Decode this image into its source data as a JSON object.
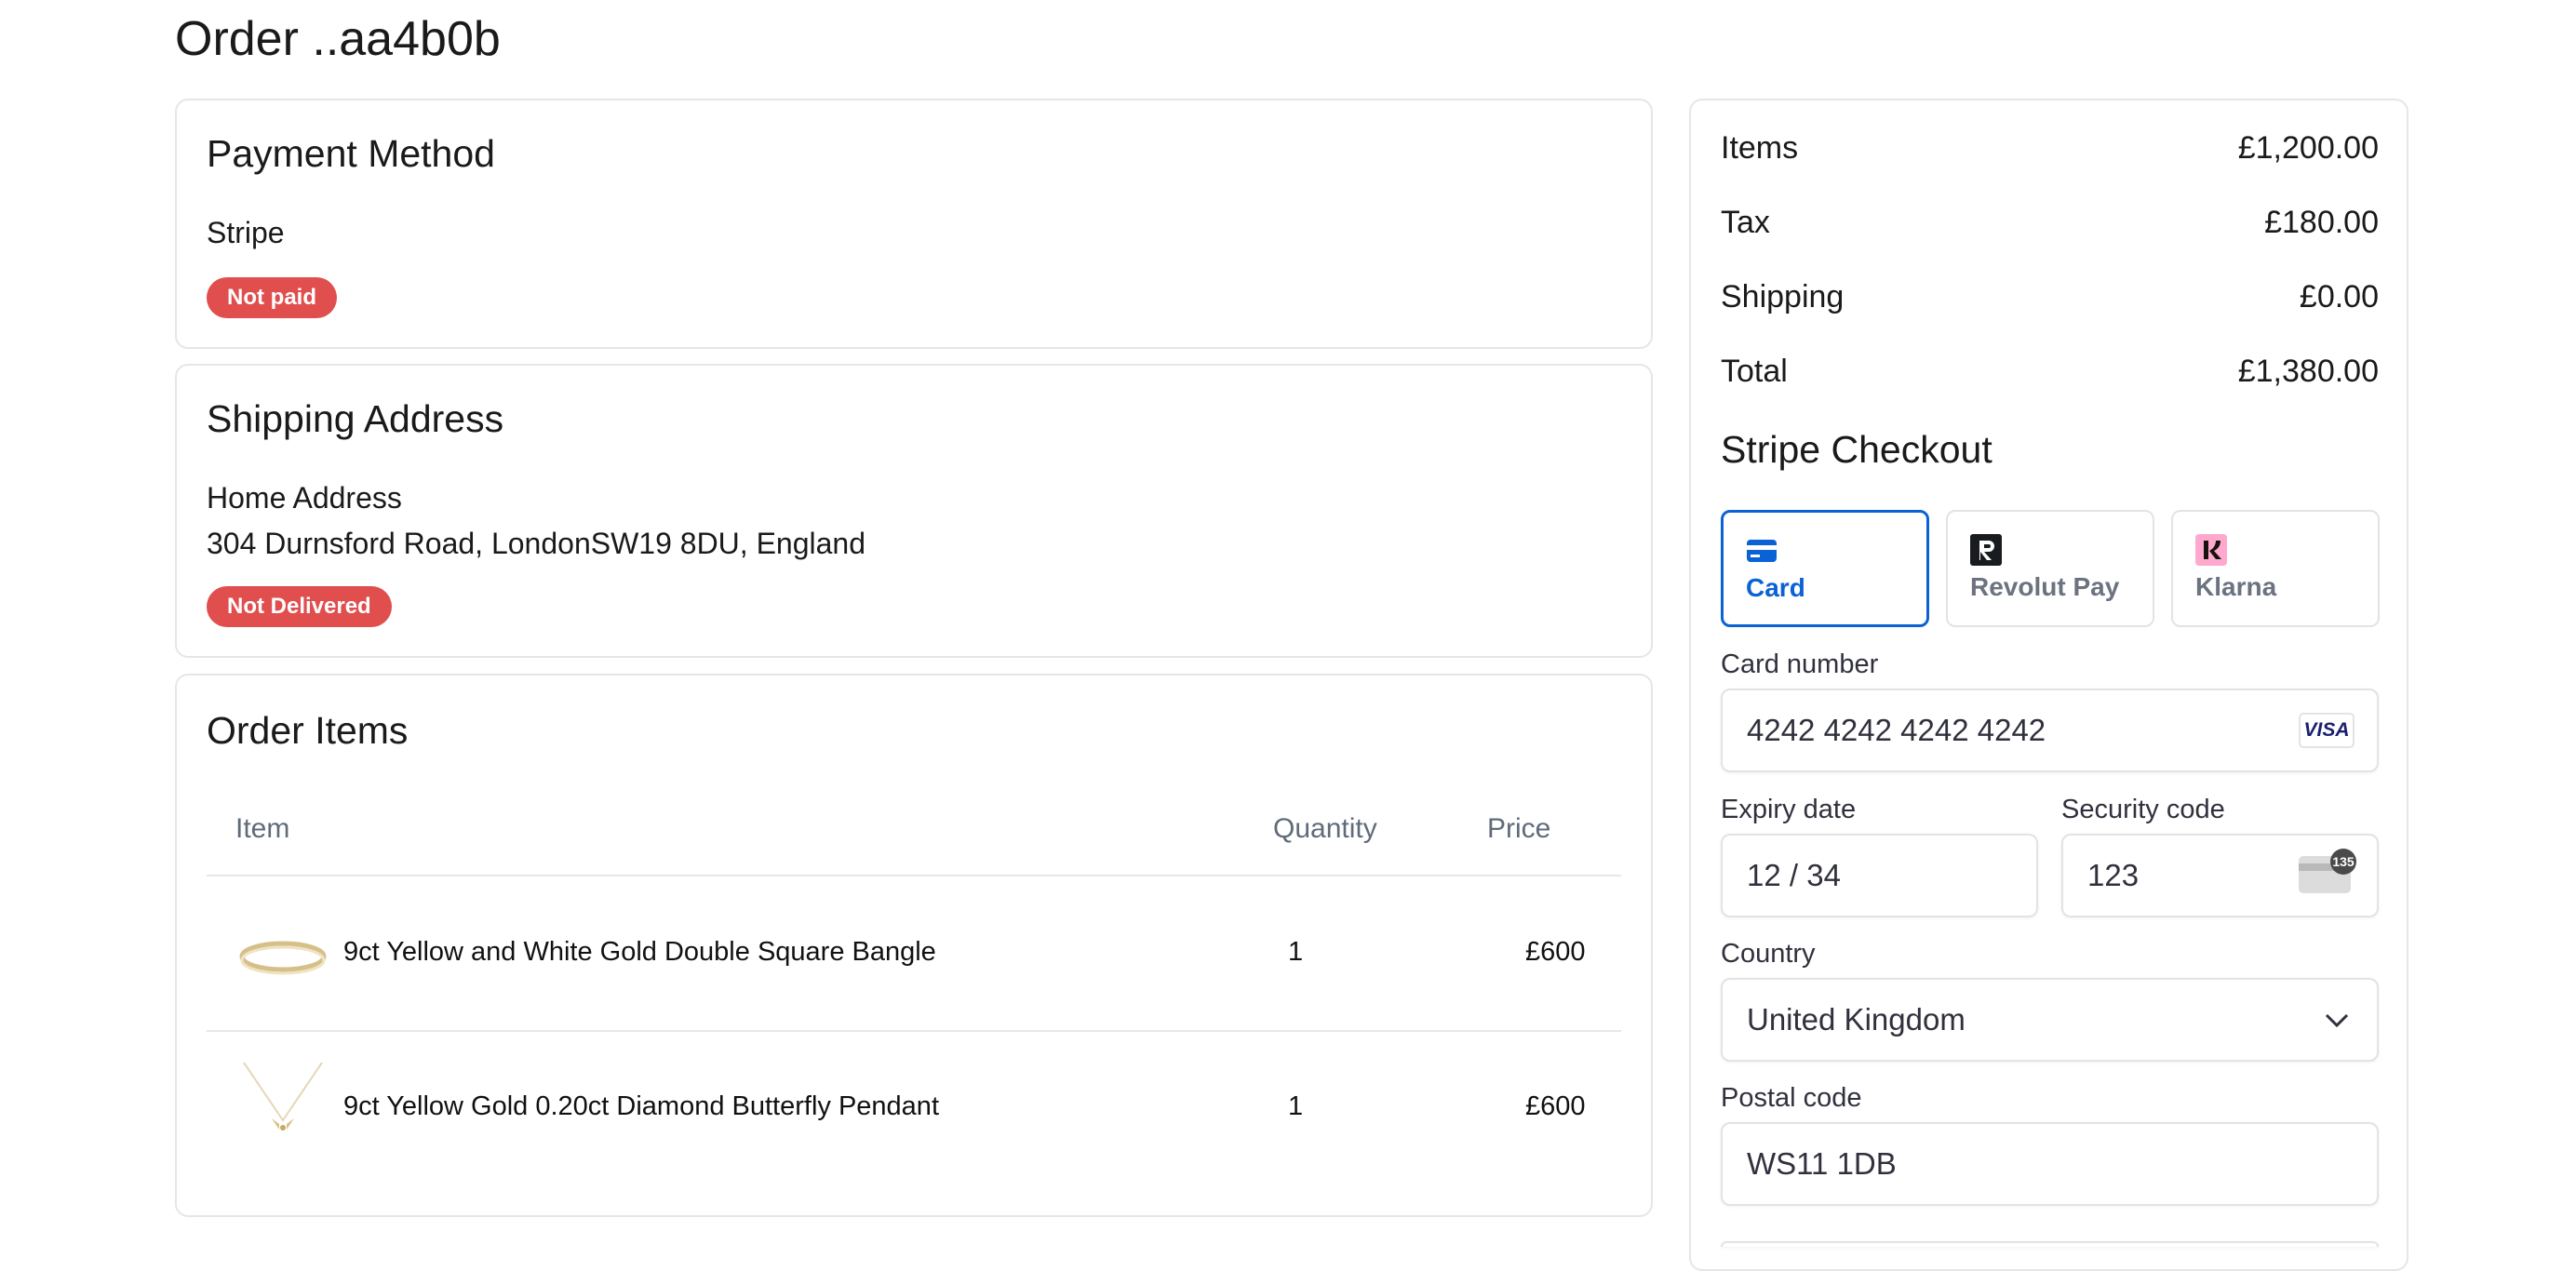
{
  "page": {
    "title": "Order ..aa4b0b"
  },
  "payment": {
    "heading": "Payment Method",
    "method": "Stripe",
    "status": "Not paid",
    "status_color": "#e04e4e"
  },
  "shipping": {
    "heading": "Shipping Address",
    "label": "Home Address",
    "address": "304 Durnsford Road, LondonSW19 8DU, England",
    "status": "Not Delivered"
  },
  "order_items": {
    "heading": "Order Items",
    "columns": {
      "item": "Item",
      "quantity": "Quantity",
      "price": "Price"
    },
    "rows": [
      {
        "image_icon": "gold-bangle-image",
        "name": "9ct Yellow and White Gold Double Square Bangle",
        "quantity": "1",
        "price": "£600"
      },
      {
        "image_icon": "butterfly-pendant-image",
        "name": "9ct Yellow Gold 0.20ct Diamond Butterfly Pendant",
        "quantity": "1",
        "price": "£600"
      }
    ]
  },
  "summary": {
    "items_label": "Items",
    "items_value": "£1,200.00",
    "tax_label": "Tax",
    "tax_value": "£180.00",
    "shipping_label": "Shipping",
    "shipping_value": "£0.00",
    "total_label": "Total",
    "total_value": "£1,380.00"
  },
  "checkout": {
    "heading": "Stripe Checkout",
    "accent_color": "#0b62d4",
    "tabs": [
      {
        "label": "Card",
        "icon": "card-icon",
        "active": true
      },
      {
        "label": "Revolut Pay",
        "icon": "revolut-icon",
        "active": false
      },
      {
        "label": "Klarna",
        "icon": "klarna-icon",
        "active": false
      }
    ],
    "card_number_label": "Card number",
    "card_number_value": "4242 4242 4242 4242",
    "card_brand": "VISA",
    "expiry_label": "Expiry date",
    "expiry_value": "12 / 34",
    "cvc_label": "Security code",
    "cvc_value": "123",
    "cvc_badge": "135",
    "country_label": "Country",
    "country_value": "United Kingdom",
    "postal_label": "Postal code",
    "postal_value": "WS11 1DB"
  }
}
